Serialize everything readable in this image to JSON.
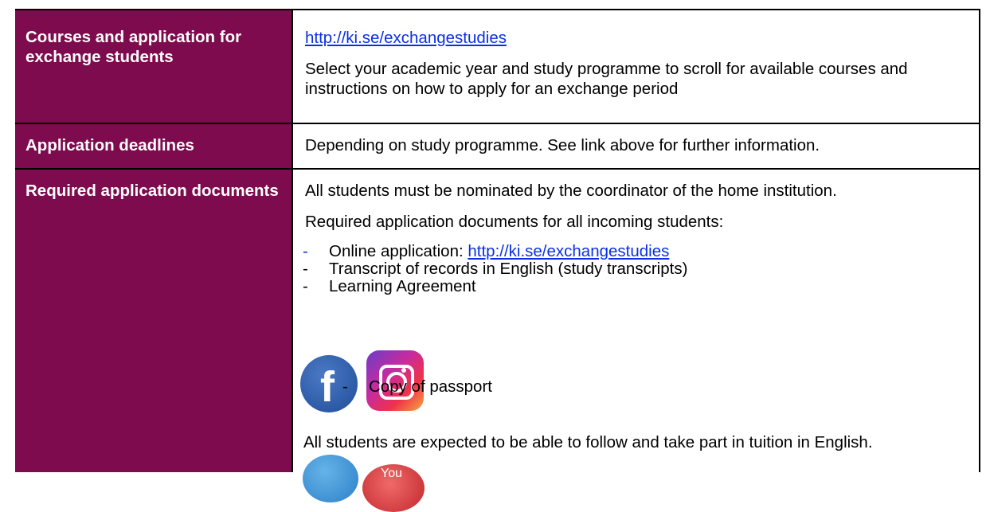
{
  "rows": [
    {
      "label": "Courses and application for exchange students",
      "link": "http://ki.se/exchangestudies",
      "text": "Select your academic year and study programme to scroll for available courses and instructions on how to apply for an exchange period"
    },
    {
      "label": "Application deadlines",
      "text": "Depending on study programme. See link above for further information."
    },
    {
      "label": "Required application documents",
      "text1": "All students must be nominated by the coordinator of the home institution.",
      "text2": "Required application documents for all incoming students:",
      "docs": [
        {
          "dash": "-",
          "prefix": "Online application: ",
          "link": "http://ki.se/exchangestudies"
        },
        {
          "dash": "-",
          "text": "Transcript of records in English (study transcripts)"
        },
        {
          "dash": "-",
          "text": "Learning Agreement"
        },
        {
          "dash": "-",
          "text": "Copy of passport"
        }
      ],
      "text3": "All students are expected to be able to follow and take part in tuition in English."
    }
  ],
  "social": {
    "facebook": "facebook-icon",
    "instagram": "instagram-icon",
    "twitter": "twitter-icon",
    "youtube": "youtube-icon",
    "youtube_text": "You"
  },
  "colors": {
    "label_bg": "#7d0b4d",
    "link": "#0b2fe8"
  }
}
